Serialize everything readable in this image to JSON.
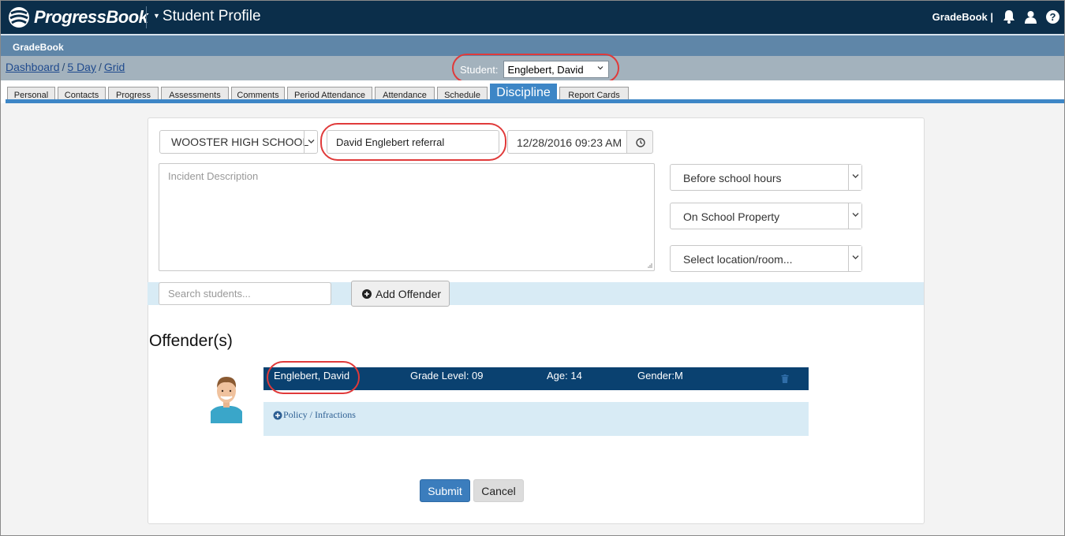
{
  "header": {
    "logo_text": "ProgressBook",
    "app_title": "Student Profile",
    "app_link": "GradeBook |"
  },
  "gradebook_bar": {
    "label": "GradeBook"
  },
  "breadcrumb": {
    "items": [
      "Dashboard",
      "5 Day",
      "Grid"
    ],
    "separator": "/"
  },
  "student_selector": {
    "label": "Student:",
    "value": "Englebert, David"
  },
  "tabs": [
    {
      "label": "Personal"
    },
    {
      "label": "Contacts"
    },
    {
      "label": "Progress"
    },
    {
      "label": "Assessments"
    },
    {
      "label": "Comments"
    },
    {
      "label": "Period Attendance"
    },
    {
      "label": "Attendance"
    },
    {
      "label": "Schedule"
    },
    {
      "label": "Discipline"
    },
    {
      "label": "Report Cards"
    }
  ],
  "active_tab": "Discipline",
  "form": {
    "school": "WOOSTER HIGH SCHOOL",
    "referral_title": "David Englebert referral",
    "datetime": "12/28/2016 09:23 AM",
    "description_placeholder": "Incident Description",
    "time_of_day": "Before school hours",
    "property": "On School Property",
    "location_placeholder": "Select location/room...",
    "search_placeholder": "Search students...",
    "add_offender_label": "Add Offender"
  },
  "offenders": {
    "heading": "Offender(s)",
    "list": [
      {
        "name": "Englebert, David",
        "grade": "Grade Level: 09",
        "age": "Age: 14",
        "gender": "Gender:M",
        "policy_link": "Policy / Infractions"
      }
    ]
  },
  "actions": {
    "submit_label": "Submit",
    "cancel_label": "Cancel"
  },
  "colors": {
    "topbar": "#0b2e4a",
    "gradebar": "#5f86a8",
    "crumbbar": "#a3b2bd",
    "accent": "#3d86c6",
    "offender_bar": "#0a4170",
    "highlight": "#e03a3a"
  }
}
